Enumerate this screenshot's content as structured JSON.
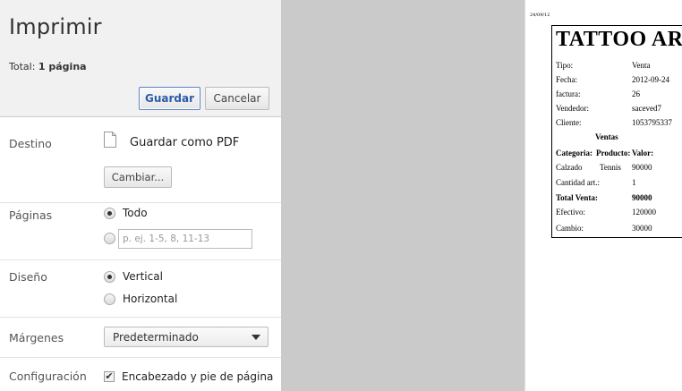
{
  "panel": {
    "title": "Imprimir",
    "total_label": "Total:",
    "total_value": "1 página",
    "save_label": "Guardar",
    "cancel_label": "Cancelar"
  },
  "destination": {
    "label": "Destino",
    "name": "Guardar como PDF",
    "change_label": "Cambiar..."
  },
  "pages": {
    "label": "Páginas",
    "all_label": "Todo",
    "range_placeholder": "p. ej. 1-5, 8, 11-13"
  },
  "layout": {
    "label": "Diseño",
    "portrait_label": "Vertical",
    "landscape_label": "Horizontal"
  },
  "margins": {
    "label": "Márgenes",
    "selected": "Predeterminado"
  },
  "options": {
    "label": "Configuración",
    "headers_label": "Encabezado y pie de página"
  },
  "preview": {
    "date": "24/09/12",
    "title": "TATTOO ARTE",
    "rows": [
      {
        "label": "Tipo:",
        "value": "Venta"
      },
      {
        "label": "Fecha:",
        "value": "2012-09-24"
      },
      {
        "label": "factura:",
        "value": "26"
      },
      {
        "label": "Vendedor:",
        "value": "saceved7"
      },
      {
        "label": "Cliente:",
        "value": "1053795337"
      }
    ],
    "section_title": "Ventas",
    "table_header": [
      "Categoria:",
      "Producto:",
      "Valor:"
    ],
    "item": {
      "category": "Calzado",
      "product": "Tennis",
      "value": "90000"
    },
    "quantity_label": "Cantidad art.:",
    "quantity_value": "1",
    "total_label": "Total Venta:",
    "total_value": "90000",
    "cash_label": "Efectivo:",
    "cash_value": "120000",
    "change_label": "Cambio:",
    "change_value": "30000"
  }
}
